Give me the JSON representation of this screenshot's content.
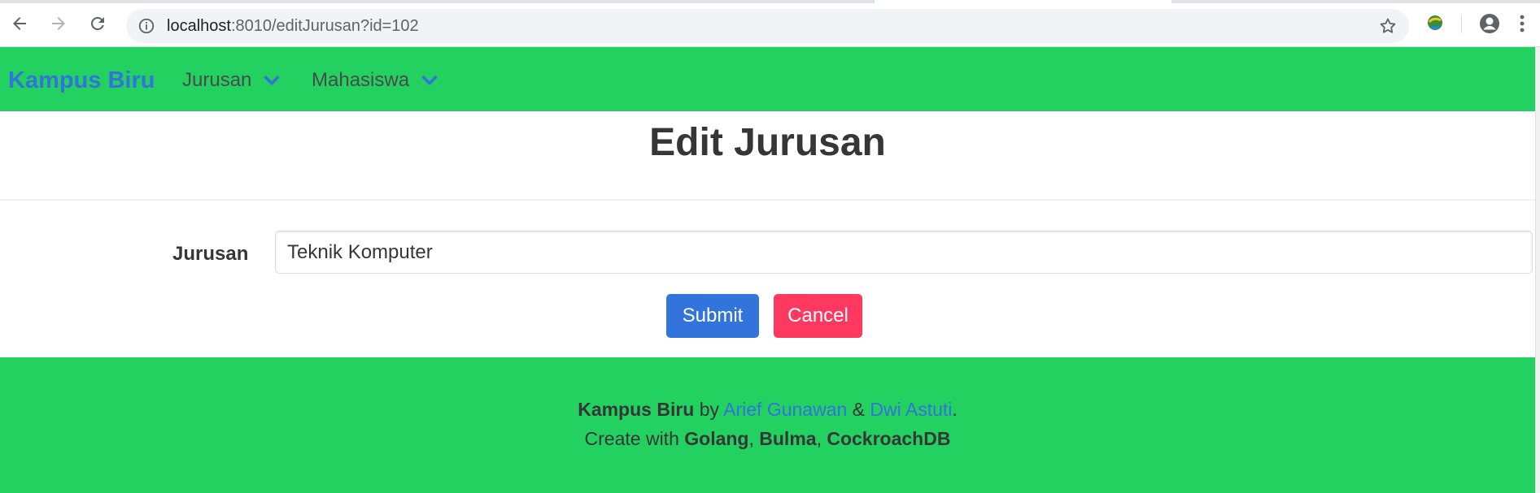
{
  "browser": {
    "url_host": "localhost",
    "url_rest": ":8010/editJurusan?id=102"
  },
  "navbar": {
    "brand": "Kampus Biru",
    "items": [
      {
        "label": "Jurusan"
      },
      {
        "label": "Mahasiswa"
      }
    ]
  },
  "page": {
    "title": "Edit Jurusan"
  },
  "form": {
    "field_label": "Jurusan",
    "field_value": "Teknik Komputer",
    "submit_label": "Submit",
    "cancel_label": "Cancel"
  },
  "footer": {
    "brand": "Kampus Biru",
    "by": " by ",
    "author1": "Arief Gunawan",
    "amp": " & ",
    "author2": "Dwi Astuti",
    "period": ".",
    "create_with": "Create with ",
    "tech1": "Golang",
    "comma1": ", ",
    "tech2": "Bulma",
    "comma2": ", ",
    "tech3": "CockroachDB"
  },
  "colors": {
    "navbar_bg": "#23d160",
    "brand": "#3273dc",
    "submit": "#3273dc",
    "cancel": "#ff3860"
  }
}
